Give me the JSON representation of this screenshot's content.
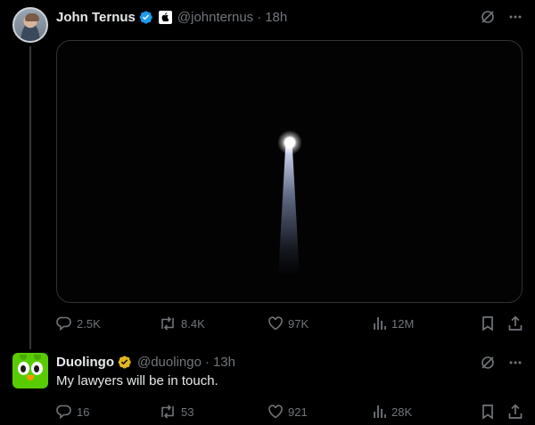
{
  "tweet1": {
    "name": "John Ternus",
    "handle": "@johnternus",
    "separator": "·",
    "time": "18h",
    "stats": {
      "replies": "2.5K",
      "reposts": "8.4K",
      "likes": "97K",
      "views": "12M"
    }
  },
  "tweet2": {
    "name": "Duolingo",
    "handle": "@duolingo",
    "separator": "·",
    "time": "13h",
    "text": "My lawyers will be in touch.",
    "stats": {
      "replies": "16",
      "reposts": "53",
      "likes": "921",
      "views": "28K"
    }
  },
  "colors": {
    "background": "#000000",
    "text": "#e7e9ea",
    "muted": "#71767b",
    "verified_blue": "#1d9bf0",
    "verified_gold": "#e2b719",
    "duolingo_green": "#58cc02"
  },
  "icons": [
    "verified-badge-icon",
    "apple-affiliation-icon",
    "grok-icon",
    "more-icon",
    "reply-icon",
    "repost-icon",
    "like-icon",
    "views-icon",
    "bookmark-icon",
    "share-icon"
  ]
}
